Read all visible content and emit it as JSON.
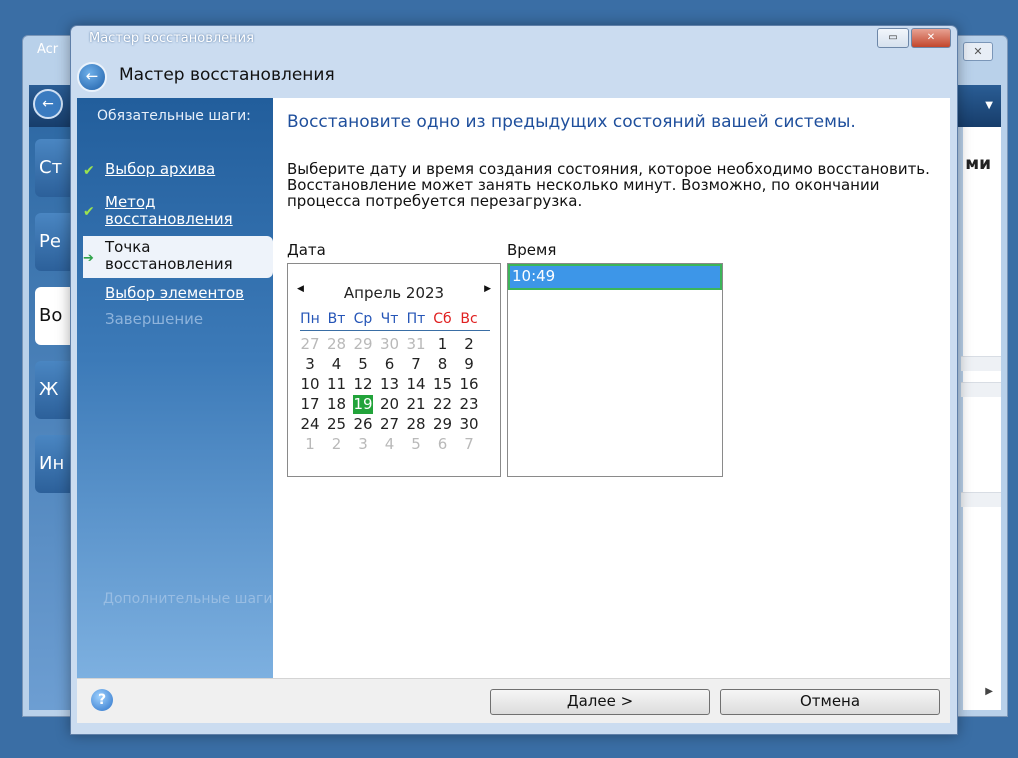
{
  "background_window": {
    "title": "Acr",
    "tiles": [
      "Ст",
      "Ре",
      "Во",
      "Ж",
      "Ин"
    ],
    "right_text": "ми"
  },
  "dialog": {
    "title": "Мастер восстановления",
    "heading": "Мастер восстановления"
  },
  "sidebar": {
    "group_label": "Обязательные шаги:",
    "items": [
      {
        "label": "Выбор архива",
        "state": "done"
      },
      {
        "label": "Метод восстановления",
        "state": "done"
      },
      {
        "label": "Точка восстановления",
        "state": "current"
      },
      {
        "label": "Выбор элементов",
        "state": "todo"
      },
      {
        "label": "Завершение",
        "state": "disabled"
      }
    ],
    "optional_label": "Дополнительные шаги"
  },
  "content": {
    "title": "Восстановите одно из предыдущих состояний вашей системы.",
    "description": "Выберите дату и время создания состояния, которое необходимо восстановить. Восстановление может занять несколько минут. Возможно, по окончании процесса потребуется перезагрузка.",
    "date_label": "Дата",
    "time_label": "Время"
  },
  "calendar": {
    "month": "Апрель 2023",
    "weekdays": [
      "Пн",
      "Вт",
      "Ср",
      "Чт",
      "Пт",
      "Сб",
      "Вс"
    ],
    "weeks": [
      [
        "27",
        "28",
        "29",
        "30",
        "31",
        "1",
        "2"
      ],
      [
        "3",
        "4",
        "5",
        "6",
        "7",
        "8",
        "9"
      ],
      [
        "10",
        "11",
        "12",
        "13",
        "14",
        "15",
        "16"
      ],
      [
        "17",
        "18",
        "19",
        "20",
        "21",
        "22",
        "23"
      ],
      [
        "24",
        "25",
        "26",
        "27",
        "28",
        "29",
        "30"
      ],
      [
        "1",
        "2",
        "3",
        "4",
        "5",
        "6",
        "7"
      ]
    ],
    "selected_day": "19"
  },
  "times": [
    "10:49"
  ],
  "footer": {
    "next_label": "Далее >",
    "cancel_label": "Отмена"
  },
  "colors": {
    "accent_selected": "#22a33a",
    "title_blue": "#1f4f9c",
    "weekend_red": "#e02020"
  }
}
